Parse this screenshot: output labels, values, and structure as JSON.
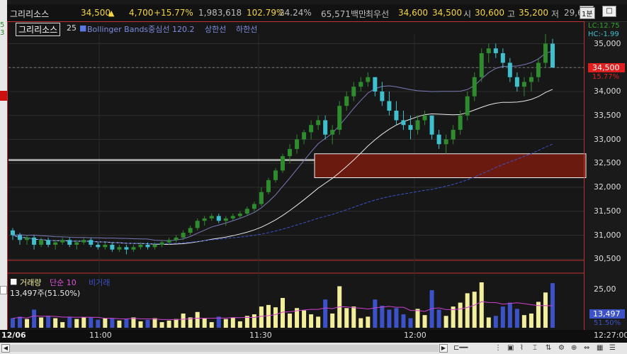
{
  "ticker": {
    "name": "그리리소스",
    "price": "34,500",
    "arrow": "▲",
    "change": "4,700",
    "change_pct": "+15.77%",
    "volume": "1,983,618",
    "vol_ratio": "102.79%",
    "turnover_pct": "24.24%",
    "amount": "65,571백만",
    "best_label": "최우선",
    "best_ask": "34,600",
    "best_bid": "34,500",
    "open_label": "시",
    "open": "30,600",
    "high_label": "고",
    "high": "35,200",
    "low_label": "저",
    "low": "29,6"
  },
  "window_buttons": {
    "minimize": "_",
    "maximize": "□"
  },
  "left_strip": {
    "top_text": "5\n3"
  },
  "price_panel": {
    "legend_name": "그리리소스",
    "legend_period": "25",
    "legend_bb": "Bollinger Bands중심선 120.2",
    "legend_upper": "상한선",
    "legend_lower": "하한선",
    "interval_label": "1분",
    "lc_label": "LC:12.75",
    "hc_label": "HC:-1.99",
    "current_price_label": "34,500",
    "current_pct_label": "15.77%",
    "y_ticks": [
      "35,000",
      "34,500",
      "34,000",
      "33,500",
      "33,000",
      "32,500",
      "32,000",
      "31,500",
      "31,000",
      "30,500"
    ]
  },
  "volume_panel": {
    "legend_name": "거래량",
    "legend_ma": "단순 10",
    "legend_ratio": "비거래",
    "current_volume": "13,497주(51.50%)",
    "y_top": "25,00",
    "current_vol_label": "13,497",
    "current_vol_pct": "51.50%"
  },
  "time_axis": {
    "date_label": "12/06",
    "ticks": [
      "11:00",
      "11:30",
      "12:00"
    ],
    "current_time": "12:27:00"
  },
  "colors": {
    "up": "#2e8b2e",
    "down": "#3fc0cf",
    "bb_upper": "#7a7ab8",
    "bb_mid": "#e8e8e8",
    "bb_lower": "#3a52c8",
    "zone_fill": "#6b1a10",
    "vol_up": "#f2ee9c",
    "vol_down": "#3b52c8",
    "vol_ma": "#d040d0"
  },
  "chart_data": {
    "type": "candlestick",
    "y_range": [
      30500,
      35000
    ],
    "highlight_zone": [
      32200,
      32700
    ],
    "candles": [
      [
        31100,
        31150,
        30900,
        31000
      ],
      [
        31000,
        31050,
        30800,
        30900
      ],
      [
        30900,
        31000,
        30800,
        30950
      ],
      [
        30950,
        31000,
        30700,
        30800
      ],
      [
        30800,
        30950,
        30750,
        30900
      ],
      [
        30900,
        30950,
        30750,
        30800
      ],
      [
        30800,
        30900,
        30700,
        30850
      ],
      [
        30850,
        30950,
        30800,
        30900
      ],
      [
        30900,
        30950,
        30750,
        30800
      ],
      [
        30800,
        30900,
        30700,
        30850
      ],
      [
        30850,
        30950,
        30800,
        30900
      ],
      [
        30900,
        30950,
        30750,
        30800
      ],
      [
        30800,
        30850,
        30700,
        30750
      ],
      [
        30750,
        30850,
        30700,
        30800
      ],
      [
        30800,
        30850,
        30650,
        30700
      ],
      [
        30700,
        30800,
        30650,
        30750
      ],
      [
        30750,
        30800,
        30600,
        30700
      ],
      [
        30700,
        30800,
        30650,
        30750
      ],
      [
        30750,
        30850,
        30700,
        30800
      ],
      [
        30800,
        30850,
        30700,
        30750
      ],
      [
        30750,
        30850,
        30700,
        30800
      ],
      [
        30800,
        30900,
        30750,
        30850
      ],
      [
        30850,
        30950,
        30800,
        30900
      ],
      [
        30900,
        31000,
        30850,
        30950
      ],
      [
        30950,
        31100,
        30900,
        31050
      ],
      [
        31050,
        31200,
        31000,
        31150
      ],
      [
        31150,
        31350,
        31100,
        31300
      ],
      [
        31300,
        31400,
        31200,
        31350
      ],
      [
        31350,
        31450,
        31300,
        31400
      ],
      [
        31400,
        31450,
        31250,
        31300
      ],
      [
        31300,
        31400,
        31200,
        31350
      ],
      [
        31350,
        31450,
        31300,
        31400
      ],
      [
        31400,
        31500,
        31350,
        31450
      ],
      [
        31450,
        31600,
        31400,
        31550
      ],
      [
        31550,
        31700,
        31500,
        31650
      ],
      [
        31650,
        32000,
        31600,
        31900
      ],
      [
        31900,
        32200,
        31850,
        32150
      ],
      [
        32150,
        32400,
        32100,
        32350
      ],
      [
        32350,
        32700,
        32300,
        32650
      ],
      [
        32650,
        32900,
        32500,
        32800
      ],
      [
        32800,
        33100,
        32700,
        33000
      ],
      [
        33000,
        33200,
        32900,
        33150
      ],
      [
        33150,
        33400,
        33000,
        33300
      ],
      [
        33300,
        33500,
        33200,
        33400
      ],
      [
        33400,
        33500,
        33000,
        33100
      ],
      [
        33100,
        33300,
        32900,
        33200
      ],
      [
        33200,
        33800,
        33100,
        33700
      ],
      [
        33700,
        34000,
        33600,
        33900
      ],
      [
        33900,
        34200,
        33800,
        34100
      ],
      [
        34100,
        34300,
        34000,
        34200
      ],
      [
        34200,
        34400,
        34100,
        34300
      ],
      [
        34300,
        34300,
        33900,
        34000
      ],
      [
        34000,
        34200,
        33700,
        33800
      ],
      [
        33800,
        34000,
        33500,
        33600
      ],
      [
        33600,
        33800,
        33300,
        33400
      ],
      [
        33400,
        33600,
        33200,
        33300
      ],
      [
        33300,
        33500,
        33000,
        33200
      ],
      [
        33200,
        33500,
        33100,
        33400
      ],
      [
        33400,
        33600,
        33300,
        33500
      ],
      [
        33500,
        33500,
        33000,
        33100
      ],
      [
        33100,
        33200,
        32800,
        32900
      ],
      [
        32900,
        33100,
        32700,
        33000
      ],
      [
        33000,
        33300,
        32900,
        33200
      ],
      [
        33200,
        33600,
        33100,
        33500
      ],
      [
        33500,
        34000,
        33400,
        33900
      ],
      [
        33900,
        34400,
        33800,
        34300
      ],
      [
        34300,
        34900,
        34200,
        34800
      ],
      [
        34800,
        35000,
        34600,
        34900
      ],
      [
        34900,
        35000,
        34700,
        34800
      ],
      [
        34800,
        34900,
        34500,
        34600
      ],
      [
        34600,
        34700,
        34200,
        34300
      ],
      [
        34300,
        34400,
        34000,
        34100
      ],
      [
        34100,
        34300,
        33900,
        34200
      ],
      [
        34200,
        34400,
        34000,
        34300
      ],
      [
        34300,
        34700,
        34200,
        34600
      ],
      [
        34600,
        35200,
        34500,
        35000
      ],
      [
        35000,
        35100,
        34500,
        34500
      ]
    ]
  }
}
